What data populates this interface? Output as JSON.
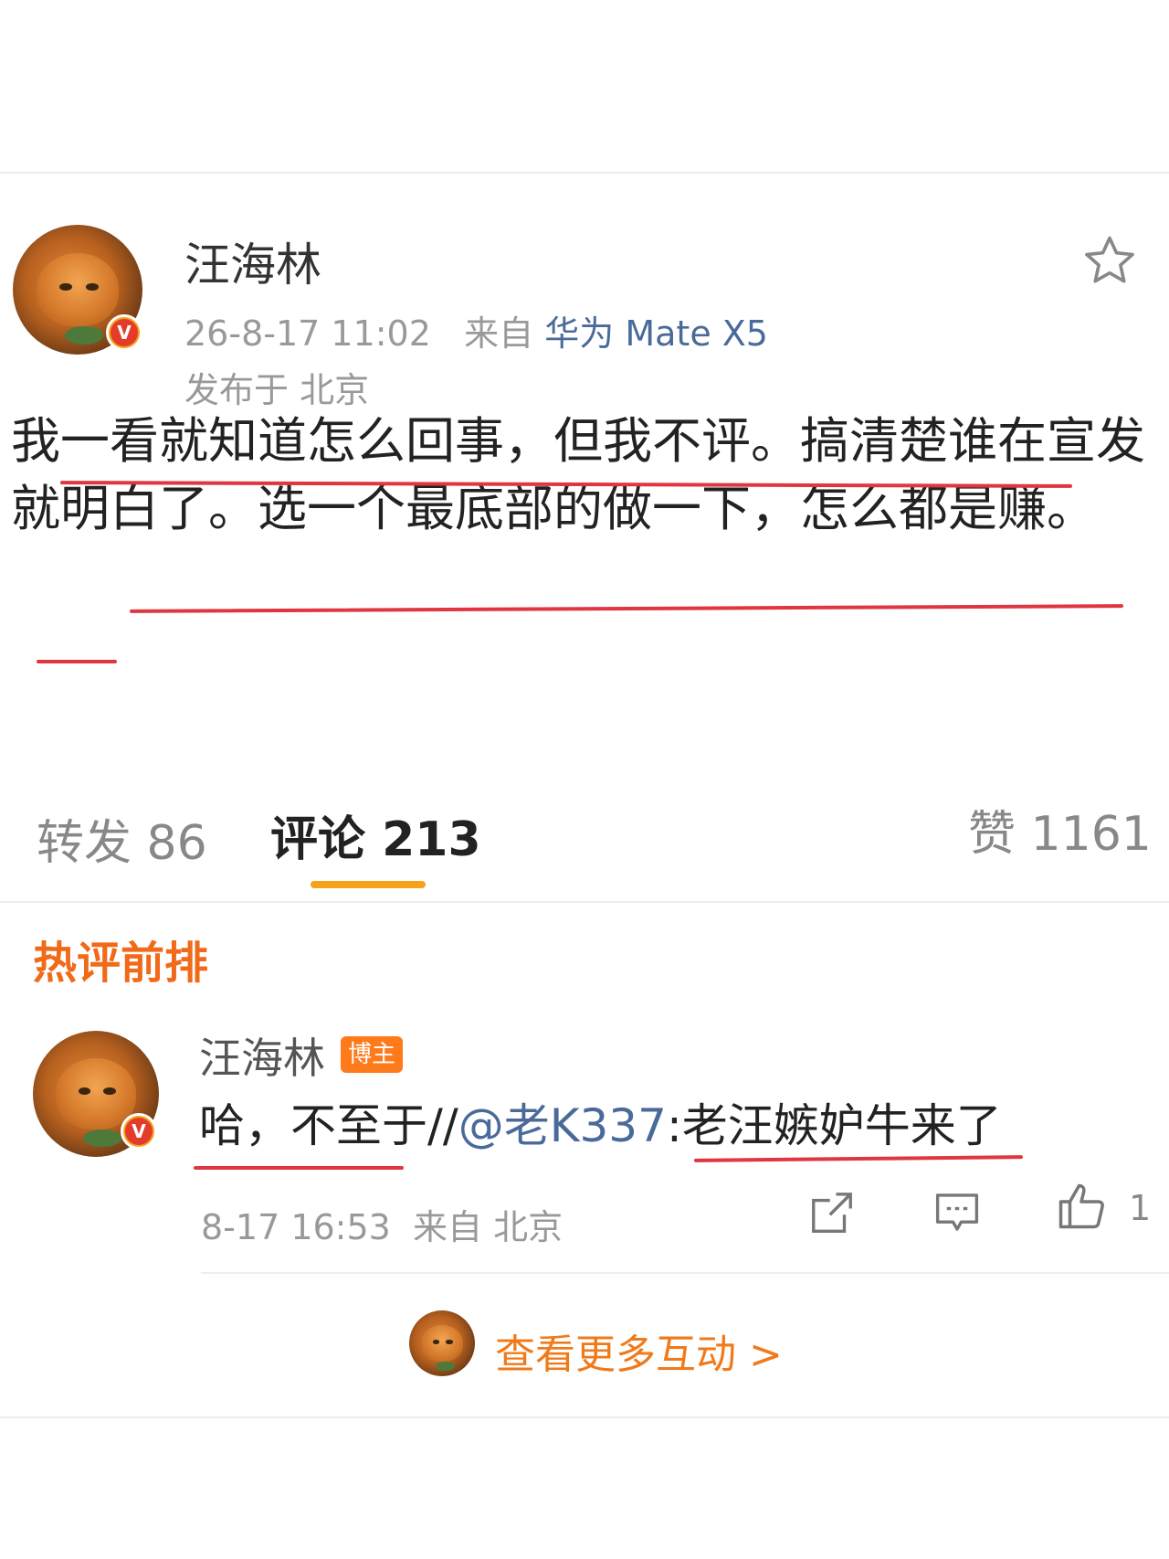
{
  "post": {
    "author": "汪海林",
    "date": "26-8-17 11:02",
    "source_prefix": "来自",
    "device": "华为 Mate X5",
    "location": "发布于 北京",
    "text": "我一看就知道怎么回事，但我不评。搞清楚谁在宣发就明白了。选一个最底部的做一下，怎么都是赚。"
  },
  "icons": {
    "favorite": "star-outline-icon",
    "verified": "verified-v-badge",
    "share": "share-icon",
    "comment": "comment-icon",
    "like": "thumbs-up-icon"
  },
  "tabs": {
    "repost": "转发 86",
    "comments": "评论 213",
    "likes": "赞 1161"
  },
  "hot_comments": {
    "heading": "热评前排",
    "items": [
      {
        "author": "汪海林",
        "badge": "博主",
        "text_before": "哈，不至于//",
        "mention": "@老K337",
        "text_after": ":老汪嫉妒牛来了",
        "time": "8-17 16:53",
        "source": "来自 北京",
        "like_count": "1"
      }
    ]
  },
  "more_interactions": "查看更多互动 >",
  "colors": {
    "accent_orange": "#f06a1a",
    "link_blue": "#4a6a9a",
    "tab_underline": "#f7a21b",
    "annotation_red": "#e0363f"
  }
}
